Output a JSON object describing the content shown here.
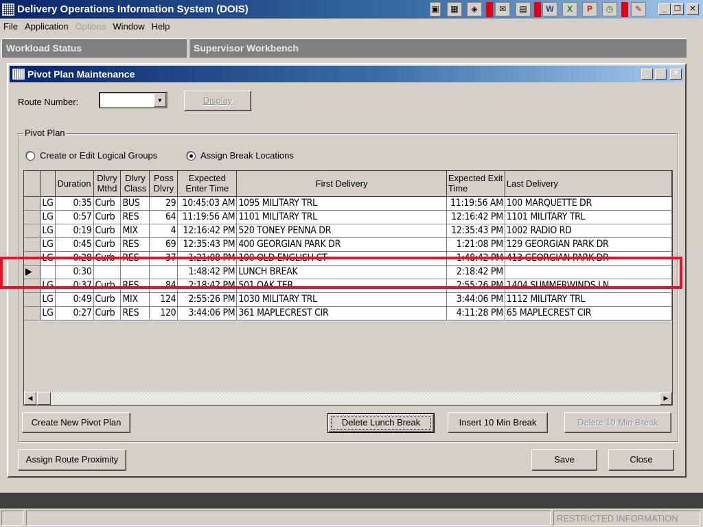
{
  "app": {
    "title": "Delivery Operations Information System (DOIS)",
    "tray_icons": [
      {
        "name": "app-switch-icon",
        "glyph": "▣"
      },
      {
        "name": "calendar-icon",
        "glyph": "▦"
      },
      {
        "name": "toolbox-icon",
        "glyph": "◈"
      },
      {
        "name": "mail-icon",
        "glyph": "✉"
      },
      {
        "name": "form-icon",
        "glyph": "▤"
      },
      {
        "name": "word-icon",
        "glyph": "W"
      },
      {
        "name": "excel-icon",
        "glyph": "X"
      },
      {
        "name": "powerpoint-icon",
        "glyph": "P"
      },
      {
        "name": "clock-icon",
        "glyph": "◷"
      },
      {
        "name": "pen-icon",
        "glyph": "✎"
      }
    ],
    "window_buttons": {
      "minimize": "_",
      "restore": "❐",
      "close": "✕"
    }
  },
  "menu": [
    {
      "label": "File",
      "enabled": true
    },
    {
      "label": "Application",
      "enabled": true
    },
    {
      "label": "Options",
      "enabled": false
    },
    {
      "label": "Window",
      "enabled": true
    },
    {
      "label": "Help",
      "enabled": true
    }
  ],
  "tabs": [
    {
      "label": "Workload Status"
    },
    {
      "label": "Supervisor Workbench"
    }
  ],
  "dialog": {
    "title": "Pivot Plan Maintenance",
    "route_number_label": "Route Number:",
    "route_number_value": "",
    "display_button": "Display",
    "group_title": "Pivot Plan",
    "radio_logical_groups": "Create or Edit Logical Groups",
    "radio_break_locations": "Assign Break Locations",
    "selected_radio": "break_locations"
  },
  "grid": {
    "columns": [
      "",
      "",
      "Duration",
      "Dlvry Mthd",
      "Dlvry Class",
      "Poss Dlvry",
      "Expected Enter Time",
      "First Delivery",
      "Expected Exit Time",
      "Last Delivery"
    ],
    "rows": [
      {
        "sel": "",
        "type": "LG",
        "duration": "0:35",
        "mthd": "Curb",
        "cls": "BUS",
        "poss": "29",
        "enter": "10:45:03 AM",
        "first": "1095 MILITARY TRL",
        "exit": "11:19:56 AM",
        "last": "100 MARQUETTE DR"
      },
      {
        "sel": "",
        "type": "LG",
        "duration": "0:57",
        "mthd": "Curb",
        "cls": "RES",
        "poss": "64",
        "enter": "11:19:56 AM",
        "first": "1101 MILITARY TRL",
        "exit": "12:16:42 PM",
        "last": "1101 MILITARY TRL"
      },
      {
        "sel": "",
        "type": "LG",
        "duration": "0:19",
        "mthd": "Curb",
        "cls": "MIX",
        "poss": "4",
        "enter": "12:16:42 PM",
        "first": "520 TONEY PENNA DR",
        "exit": "12:35:43 PM",
        "last": "1002 RADIO RD"
      },
      {
        "sel": "",
        "type": "LG",
        "duration": "0:45",
        "mthd": "Curb",
        "cls": "RES",
        "poss": "69",
        "enter": "12:35:43 PM",
        "first": "400 GEORGIAN PARK DR",
        "exit": "1:21:08 PM",
        "last": "129 GEORGIAN PARK DR"
      },
      {
        "sel": "",
        "type": "LG",
        "duration": "0:28",
        "mthd": "Curb",
        "cls": "RES",
        "poss": "37",
        "enter": "1:21:08 PM",
        "first": "100 OLD ENGLISH CT",
        "exit": "1:48:42 PM",
        "last": "413 GEORGIAN PARK DR"
      },
      {
        "sel": "▶",
        "type": "",
        "duration": "0:30",
        "mthd": "",
        "cls": "",
        "poss": "",
        "enter": "1:48:42 PM",
        "first": "LUNCH BREAK",
        "exit": "2:18:42 PM",
        "last": ""
      },
      {
        "sel": "",
        "type": "LG",
        "duration": "0:37",
        "mthd": "Curb",
        "cls": "RES",
        "poss": "84",
        "enter": "2:18:42 PM",
        "first": "501 OAK TER",
        "exit": "2:55:26 PM",
        "last": "1404 SUMMERWINDS LN"
      },
      {
        "sel": "",
        "type": "LG",
        "duration": "0:49",
        "mthd": "Curb",
        "cls": "MIX",
        "poss": "124",
        "enter": "2:55:26 PM",
        "first": "1030 MILITARY TRL",
        "exit": "3:44:06 PM",
        "last": "1112 MILITARY TRL"
      },
      {
        "sel": "",
        "type": "LG",
        "duration": "0:27",
        "mthd": "Curb",
        "cls": "RES",
        "poss": "120",
        "enter": "3:44:06 PM",
        "first": "361 MAPLECREST CIR",
        "exit": "4:11:28 PM",
        "last": "65 MAPLECREST CIR"
      }
    ]
  },
  "buttons": {
    "create_new_pivot_plan": "Create New Pivot Plan",
    "delete_lunch_break": "Delete Lunch Break",
    "insert_10_min_break": "Insert 10 Min Break",
    "delete_10_min_break": "Delete 10 Min Break",
    "assign_route_proximity": "Assign Route Proximity",
    "save": "Save",
    "close": "Close"
  },
  "status": {
    "right_text": "RESTRICTED INFORMATION"
  },
  "colors": {
    "highlight": "#e8102a",
    "titlebar": "#0a246a",
    "face": "#d4d0c8"
  }
}
